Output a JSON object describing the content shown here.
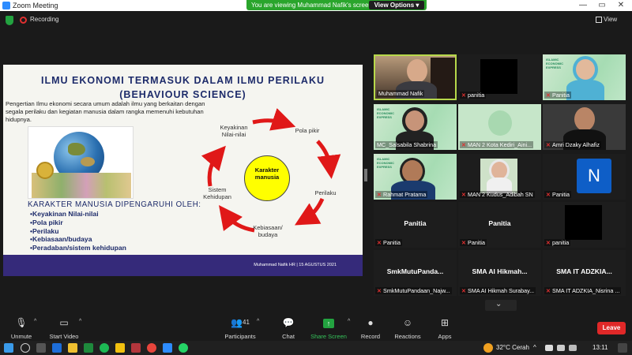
{
  "window": {
    "title": "Zoom Meeting",
    "minimize": "—",
    "maximize": "▭",
    "close": "✕"
  },
  "share_banner": {
    "text": "You are viewing Muhammad Nafik's screen",
    "view_options": "View Options ▾"
  },
  "top": {
    "recording": "Recording",
    "view": "View"
  },
  "slide": {
    "title_line1": "ILMU EKONOMI TERMASUK DALAM ILMU PERILAKU",
    "title_line2": "(BEHAVIOUR SCIENCE)",
    "paragraph": "Pengertian Ilmu ekonomi secara umum adalah ilmu yang berkaitan dengan segala perilaku dan kegiatan  manusia dalam rangka memenuhi kebutuhan hidupnya.",
    "karakter_heading": "KARAKTER MANUSIA DIPENGARUHI OLEH:",
    "karakter_items": [
      "•Keyakinan Nilai-nilai",
      "•Pola pikir",
      "•Perilaku",
      "•Kebiasaan/budaya",
      "•Peradaban/sistem kehidupan"
    ],
    "cycle": {
      "keyakinan": "Keyakinan\nNilai-nilai",
      "pola_pikir": "Pola pikir",
      "perilaku": "Perilaku",
      "kebiasaan": "Kebiasaan/\nbudaya",
      "sistem": "Sistem\nKehidupan",
      "center": "Karakter\nmanusia"
    },
    "footer": "Muhammad Nafik HR | 15 AGUSTUS 2021"
  },
  "participants": [
    {
      "name": "Muhammad Nafik",
      "muted": false
    },
    {
      "name": "panitia",
      "muted": true
    },
    {
      "name": "Panitia",
      "muted": true
    },
    {
      "name": "MC_Salsabila Shabrina",
      "muted": false
    },
    {
      "name": "MAN 2 Kota Kediri_Aini...",
      "muted": true
    },
    {
      "name": "Amri Dzaky Alhafiz",
      "muted": true
    },
    {
      "name": "Rahmat Pratama",
      "muted": true
    },
    {
      "name": "MAN 2 Kudus_Adibah SN",
      "muted": true
    },
    {
      "name": "Panitia",
      "muted": true,
      "avatar": "N"
    },
    {
      "name": "Panitia",
      "muted": true,
      "big": "Panitia"
    },
    {
      "name": "Panitia",
      "muted": true,
      "big": "Panitia"
    },
    {
      "name": "panitia",
      "muted": true
    },
    {
      "name": "SmkMutuPandaan_Najw...",
      "muted": true,
      "big": "SmkMutuPanda..."
    },
    {
      "name": "SMA AI Hikmah Surabay...",
      "muted": true,
      "big": "SMA AI Hikmah..."
    },
    {
      "name": "SMA IT ADZKIA_Nisrina ...",
      "muted": true,
      "big": "SMA IT ADZKIA..."
    }
  ],
  "toolbar": {
    "unmute": "Unmute",
    "start_video": "Start Video",
    "participants": "Participants",
    "participants_count": "41",
    "chat": "Chat",
    "share_screen": "Share Screen",
    "record": "Record",
    "reactions": "Reactions",
    "apps": "Apps",
    "leave": "Leave"
  },
  "ie_logo_text": "ISLAMIC\nECONOMIC\nEXPRESS",
  "taskbar": {
    "weather": "32°C  Cerah",
    "time": "13:11",
    "lang": "^"
  },
  "colors": {
    "accent_green": "#23a340",
    "leave_red": "#e02828",
    "slide_footer": "#352a7a",
    "slide_title": "#1d2b6a"
  }
}
